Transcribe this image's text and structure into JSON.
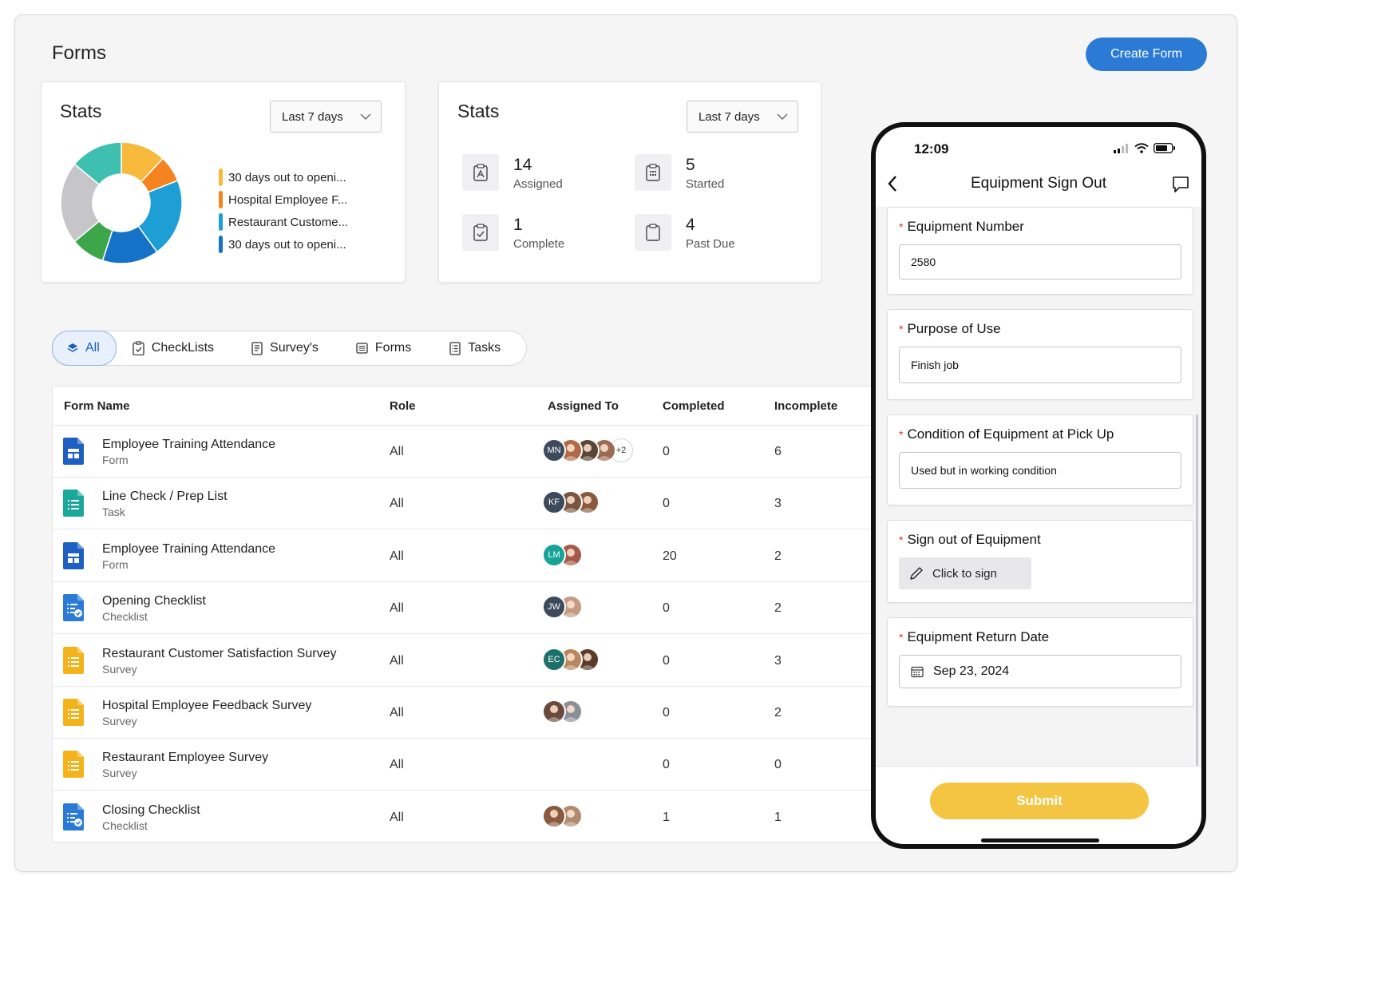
{
  "page": {
    "title": "Forms",
    "create_label": "Create Form"
  },
  "colors": {
    "accent": "#2a7ad6",
    "submit": "#f4c542",
    "required": "#e0342e"
  },
  "stats_chart": {
    "title": "Stats",
    "range": "Last 7 days",
    "legend": [
      {
        "label": "30 days out to openi...",
        "color": "#f6b93b"
      },
      {
        "label": "Hospital Employee F...",
        "color": "#f5831f"
      },
      {
        "label": "Restaurant Custome...",
        "color": "#1d9fd6"
      },
      {
        "label": "30 days out to openi...",
        "color": "#1572c7"
      }
    ]
  },
  "chart_data": {
    "type": "pie",
    "donut": true,
    "slices": [
      {
        "value": 12,
        "color": "#f6b93b"
      },
      {
        "value": 7,
        "color": "#f5831f"
      },
      {
        "value": 21,
        "color": "#1d9fd6"
      },
      {
        "value": 15,
        "color": "#1572c7"
      },
      {
        "value": 9,
        "color": "#3da54a"
      },
      {
        "value": 22,
        "color": "#c6c6c8"
      },
      {
        "value": 14,
        "color": "#3fbfb0"
      }
    ]
  },
  "stats_summary": {
    "title": "Stats",
    "range": "Last 7 days",
    "items": [
      {
        "value": "14",
        "label": "Assigned",
        "icon": "clipboard-person-icon"
      },
      {
        "value": "5",
        "label": "Started",
        "icon": "clipboard-grid-icon"
      },
      {
        "value": "1",
        "label": "Complete",
        "icon": "clipboard-check-icon"
      },
      {
        "value": "4",
        "label": "Past Due",
        "icon": "clipboard-icon"
      }
    ]
  },
  "tabs": [
    {
      "label": "All",
      "icon": "layers-icon",
      "active": true
    },
    {
      "label": "CheckLists",
      "icon": "clipboard-check-icon"
    },
    {
      "label": "Survey's",
      "icon": "document-list-icon"
    },
    {
      "label": "Forms",
      "icon": "form-icon"
    },
    {
      "label": "Tasks",
      "icon": "task-icon"
    }
  ],
  "table": {
    "headers": {
      "name": "Form Name",
      "role": "Role",
      "assigned": "Assigned To",
      "completed": "Completed",
      "incomplete": "Incomplete"
    },
    "rows": [
      {
        "name": "Employee Training Attendance",
        "type": "Form",
        "icon": "form-doc-icon",
        "icon_color": "#1e5fc2",
        "role": "All",
        "completed": "0",
        "incomplete": "6",
        "avatars": [
          {
            "initials": "MN",
            "color": "#3c4a5c"
          },
          {
            "initials": "",
            "color": "#b06a48"
          },
          {
            "initials": "",
            "color": "#5b4636"
          },
          {
            "initials": "",
            "color": "#9b6b52"
          }
        ],
        "more": "+2"
      },
      {
        "name": "Line Check / Prep List",
        "type": "Task",
        "icon": "list-doc-icon",
        "icon_color": "#1ba89a",
        "role": "All",
        "completed": "0",
        "incomplete": "3",
        "avatars": [
          {
            "initials": "KF",
            "color": "#3c4a5c"
          },
          {
            "initials": "",
            "color": "#7a5640"
          },
          {
            "initials": "",
            "color": "#8a5a3e"
          }
        ],
        "more": ""
      },
      {
        "name": "Employee Training Attendance",
        "type": "Form",
        "icon": "form-doc-icon",
        "icon_color": "#1e5fc2",
        "role": "All",
        "completed": "20",
        "incomplete": "2",
        "avatars": [
          {
            "initials": "LM",
            "color": "#17a398"
          },
          {
            "initials": "",
            "color": "#a45a4a"
          }
        ],
        "more": ""
      },
      {
        "name": "Opening Checklist",
        "type": "Checklist",
        "icon": "checklist-doc-icon",
        "icon_color": "#2a7ad6",
        "role": "All",
        "completed": "0",
        "incomplete": "2",
        "avatars": [
          {
            "initials": "JW",
            "color": "#3c4a5c"
          },
          {
            "initials": "",
            "color": "#c49a80"
          }
        ],
        "more": ""
      },
      {
        "name": "Restaurant Customer Satisfaction Survey",
        "type": "Survey",
        "icon": "survey-doc-icon",
        "icon_color": "#f5b31b",
        "role": "All",
        "completed": "0",
        "incomplete": "3",
        "avatars": [
          {
            "initials": "EC",
            "color": "#1d6f6a"
          },
          {
            "initials": "",
            "color": "#b8875e"
          },
          {
            "initials": "",
            "color": "#5a3a2a"
          }
        ],
        "more": ""
      },
      {
        "name": "Hospital Employee Feedback Survey",
        "type": "Survey",
        "icon": "survey-doc-icon",
        "icon_color": "#f5b31b",
        "role": "All",
        "completed": "0",
        "incomplete": "2",
        "avatars": [
          {
            "initials": "",
            "color": "#6a4a3c"
          },
          {
            "initials": "",
            "color": "#8a8f98"
          }
        ],
        "more": ""
      },
      {
        "name": "Restaurant Employee Survey",
        "type": "Survey",
        "icon": "survey-doc-icon",
        "icon_color": "#f5b31b",
        "role": "All",
        "completed": "0",
        "incomplete": "0",
        "avatars": [],
        "more": ""
      },
      {
        "name": "Closing Checklist",
        "type": "Checklist",
        "icon": "checklist-doc-icon",
        "icon_color": "#2a7ad6",
        "role": "All",
        "completed": "1",
        "incomplete": "1",
        "avatars": [
          {
            "initials": "",
            "color": "#8a5a3e"
          },
          {
            "initials": "",
            "color": "#b08a70"
          }
        ],
        "more": ""
      }
    ]
  },
  "phone": {
    "time": "12:09",
    "title": "Equipment Sign Out",
    "fields": [
      {
        "label": "Equipment Number",
        "value": "2580",
        "kind": "text"
      },
      {
        "label": "Purpose of Use",
        "value": "Finish job",
        "kind": "text"
      },
      {
        "label": "Condition of Equipment at Pick Up",
        "value": "Used but in working condition",
        "kind": "text"
      },
      {
        "label": "Sign out of Equipment",
        "value": "Click to sign",
        "kind": "sign"
      },
      {
        "label": "Equipment Return Date",
        "value": "Sep 23, 2024",
        "kind": "date"
      }
    ],
    "submit_label": "Submit"
  }
}
